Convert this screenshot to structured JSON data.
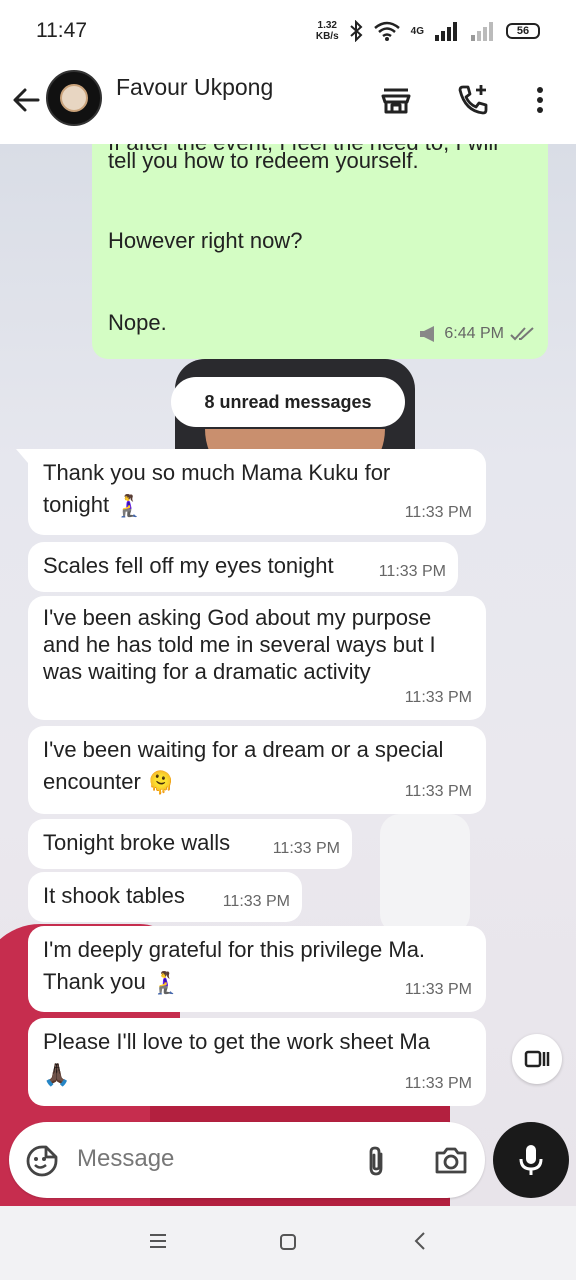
{
  "status_bar": {
    "time": "11:47",
    "net_speed_value": "1.32",
    "net_speed_unit": "KB/s",
    "network_type": "4G",
    "battery": "56"
  },
  "header": {
    "contact_name": "Favour Ukpong"
  },
  "messages_outgoing": {
    "lines": [
      "If after the event, I feel the need to, I will",
      "tell you how to redeem yourself.",
      "However right now?",
      "Nope."
    ],
    "time": "6:44 PM"
  },
  "unread_label": "8 unread messages",
  "messages_incoming": [
    {
      "lines": [
        "Thank you so much Mama Kuku for",
        "tonight"
      ],
      "emoji": "🧎‍♀️",
      "time": "11:33 PM"
    },
    {
      "lines": [
        "Scales fell off my eyes tonight"
      ],
      "time": "11:33 PM"
    },
    {
      "lines": [
        "I've been asking God about my purpose",
        "and he has told me in several ways but I",
        "was waiting for a dramatic activity"
      ],
      "time": "11:33 PM"
    },
    {
      "lines": [
        "I've been waiting for a dream or a special",
        "encounter"
      ],
      "emoji": "🫠",
      "time": "11:33 PM"
    },
    {
      "lines": [
        "Tonight broke walls"
      ],
      "time": "11:33 PM"
    },
    {
      "lines": [
        "It shook tables"
      ],
      "time": "11:33 PM"
    },
    {
      "lines": [
        "I'm deeply grateful for this privilege Ma.",
        "Thank you"
      ],
      "emoji": "🧎‍♀️",
      "time": "11:33 PM"
    },
    {
      "lines": [
        "Please I'll love to get the work sheet Ma"
      ],
      "emoji": "🙏🏿",
      "time": "11:33 PM"
    }
  ],
  "composer": {
    "placeholder": "Message"
  },
  "icons": {
    "back": "arrow-left-icon",
    "shop": "store-icon",
    "call": "add-call-icon",
    "menu": "more-vertical-icon",
    "sticker": "sticker-icon",
    "attach": "paperclip-icon",
    "camera": "camera-icon",
    "mic": "microphone-icon"
  },
  "colors": {
    "outgoing_bubble": "#d4fdc4",
    "incoming_bubble": "#ffffff",
    "mic_button": "#1a1a1a"
  }
}
